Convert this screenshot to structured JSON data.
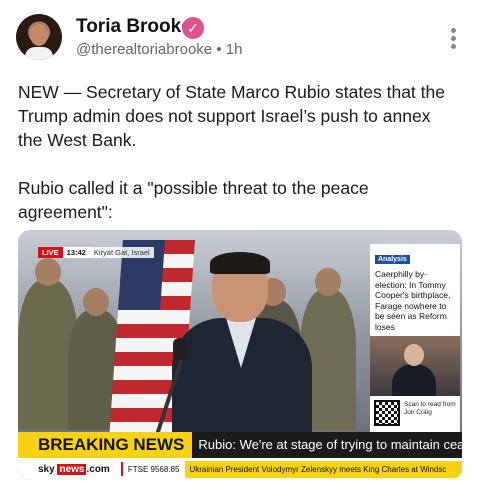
{
  "author": {
    "display_name": "Toria Brooke",
    "verified_icon": "checkmark-icon",
    "verified_mark": "✓",
    "handle": "@therealtoriabrooke",
    "separator": "•",
    "time": "1h"
  },
  "menu": {
    "icon": "more-vertical-icon"
  },
  "post": {
    "paragraph_1": "NEW — Secretary of State Marco Rubio states that the Trump admin does not support Israel’s push to annex the West Bank.",
    "paragraph_2": "Rubio called it a \"possible threat to the peace agreement\":"
  },
  "media": {
    "live_label": "LIVE",
    "clock": "13:42",
    "location": "Kiryat Gat, Israel",
    "analysis_tag": "Analysis",
    "analysis_text": "Caerphilly by-election: In Tommy Cooper's birthplace, Farage nowhere to be seen as Reform loses",
    "qr_text": "Scan to read from Jon Craig",
    "breaking_label": "BREAKING NEWS",
    "headline": "Rubio: We're at stage of trying to maintain ceasefire",
    "brand_sky": "sky",
    "brand_news": "news",
    "brand_com": ".com",
    "ftse": "FTSE 9568.85",
    "crawl": "Ukrainian President Volodymyr Zelenskyy meets King Charles at Windsc",
    "colors": {
      "live_red": "#d1121b",
      "breaking_yellow": "#f7d215",
      "analysis_blue": "#1d4fa3",
      "verified_pink": "#e0528c"
    }
  }
}
